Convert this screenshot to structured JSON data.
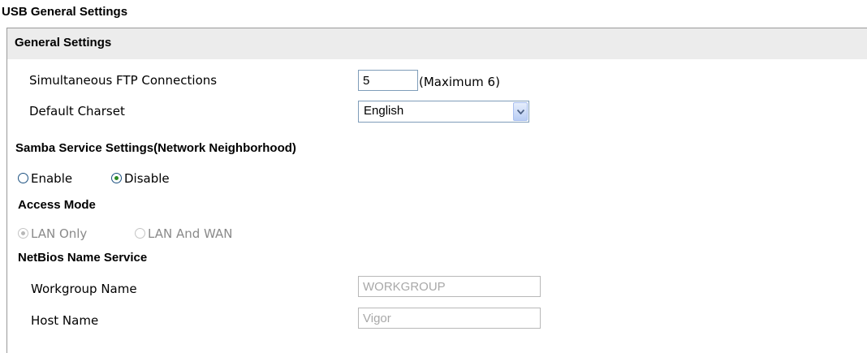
{
  "page": {
    "title": "USB General Settings"
  },
  "general": {
    "section_title": "General Settings",
    "ftp_label": "Simultaneous FTP Connections",
    "ftp_value": "5",
    "ftp_hint": "(Maximum 6)",
    "charset_label": "Default Charset",
    "charset_value": "English"
  },
  "samba": {
    "title": "Samba Service Settings(Network Neighborhood)",
    "enable_label": "Enable",
    "disable_label": "Disable",
    "selected": "Disable",
    "access_mode_title": "Access Mode",
    "lan_only_label": "LAN Only",
    "lan_wan_label": "LAN And WAN",
    "access_selected": "LAN Only",
    "netbios_title": "NetBios Name Service",
    "workgroup_label": "Workgroup Name",
    "workgroup_value": "WORKGROUP",
    "host_label": "Host Name",
    "host_value": "Vigor"
  }
}
